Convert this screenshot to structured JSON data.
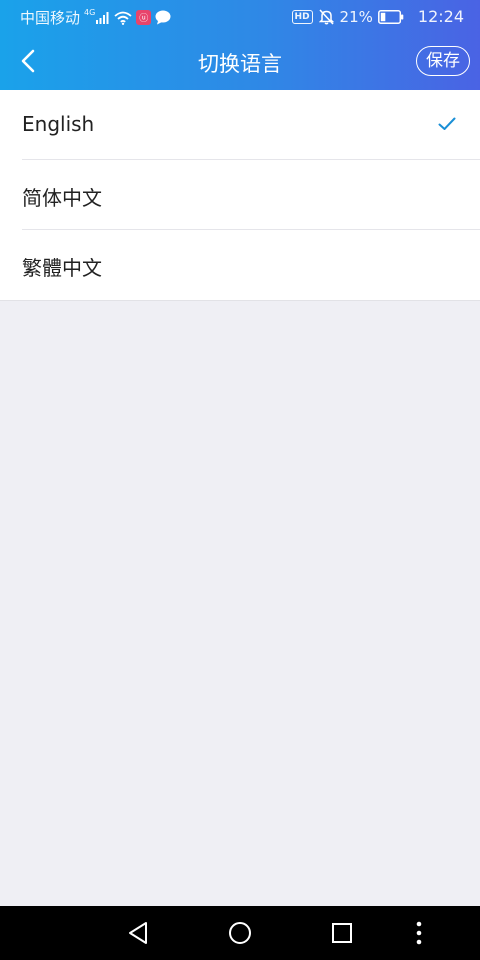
{
  "status_bar": {
    "carrier": "中国移动",
    "network": "4G",
    "app_badge": "ⓤ",
    "hd_label": "HD",
    "battery": "21%",
    "time": "12:24"
  },
  "header": {
    "title": "切换语言",
    "save_label": "保存",
    "back_icon": "chevron-left-icon"
  },
  "languages": [
    {
      "label": "English",
      "selected": true
    },
    {
      "label": "简体中文",
      "selected": false
    },
    {
      "label": "繁體中文",
      "selected": false
    }
  ],
  "colors": {
    "header_gradient_start": "#1aa2ea",
    "header_gradient_end": "#4a63e4",
    "check_color": "#1a8fd6",
    "background": "#efeff4"
  },
  "nav_bar": {
    "back": "triangle-back-icon",
    "home": "circle-home-icon",
    "recents": "square-recents-icon",
    "menu": "three-dots-menu-icon"
  }
}
